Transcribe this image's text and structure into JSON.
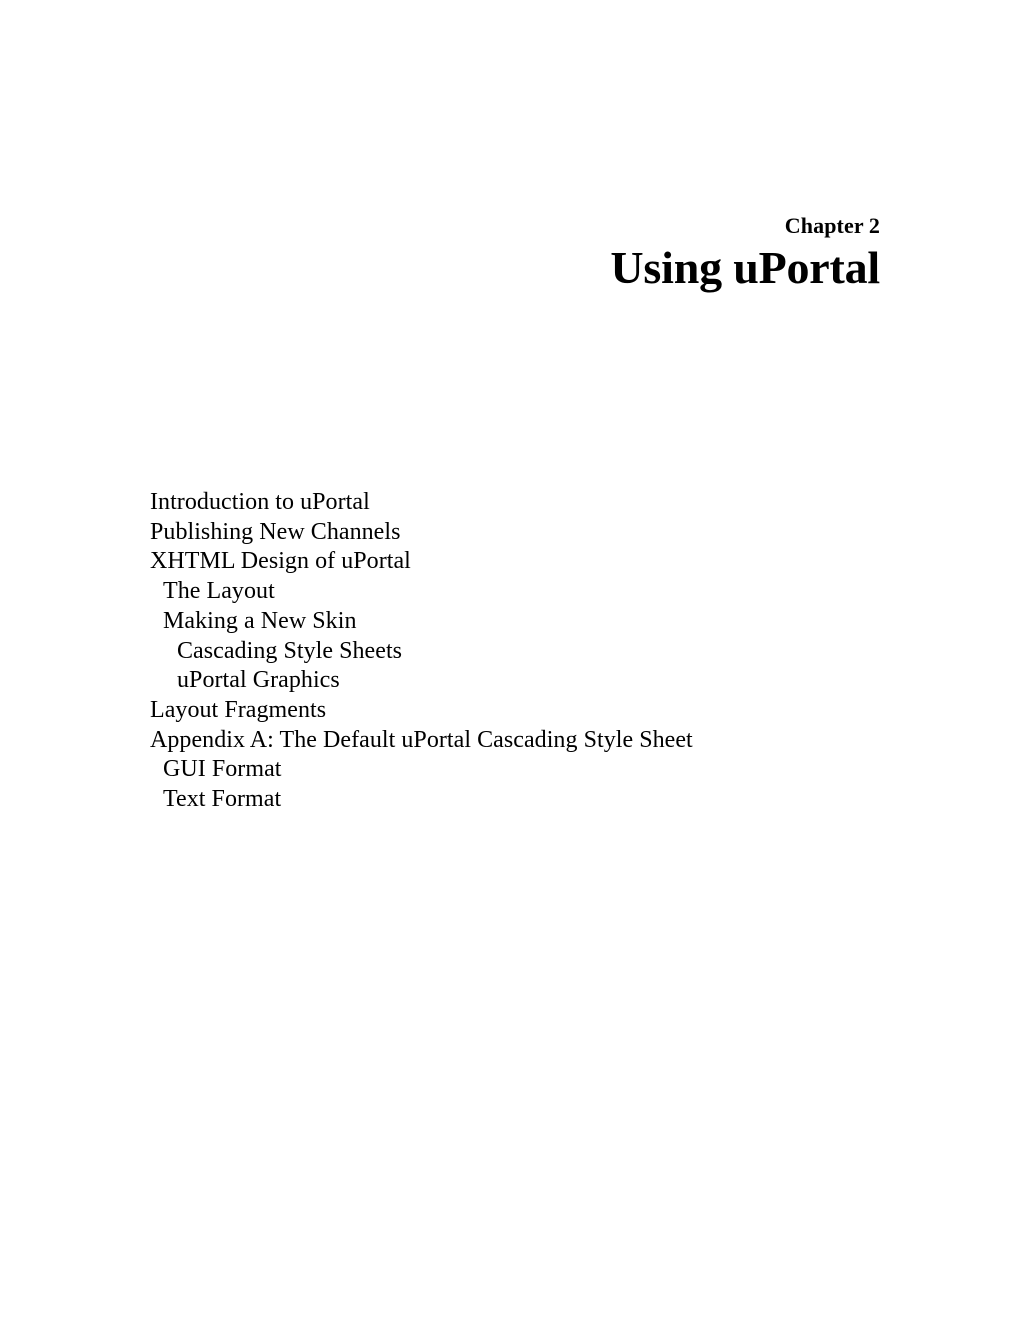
{
  "document": {
    "chapter_label": "Chapter 2",
    "chapter_title": "Using uPortal",
    "background_color": "#ffffff",
    "text_color": "#000000"
  },
  "toc": {
    "items": [
      {
        "label": "Introduction to uPortal",
        "level": 0
      },
      {
        "label": "Publishing New Channels",
        "level": 0
      },
      {
        "label": "XHTML Design of uPortal",
        "level": 0
      },
      {
        "label": "The Layout",
        "level": 1
      },
      {
        "label": "Making a New Skin",
        "level": 1
      },
      {
        "label": "Cascading Style Sheets",
        "level": 2
      },
      {
        "label": "uPortal Graphics",
        "level": 2
      },
      {
        "label": "Layout Fragments",
        "level": 0
      },
      {
        "label": "Appendix A: The Default uPortal Cascading Style Sheet",
        "level": 0
      },
      {
        "label": "GUI Format",
        "level": 1
      },
      {
        "label": "Text Format",
        "level": 1
      }
    ]
  }
}
